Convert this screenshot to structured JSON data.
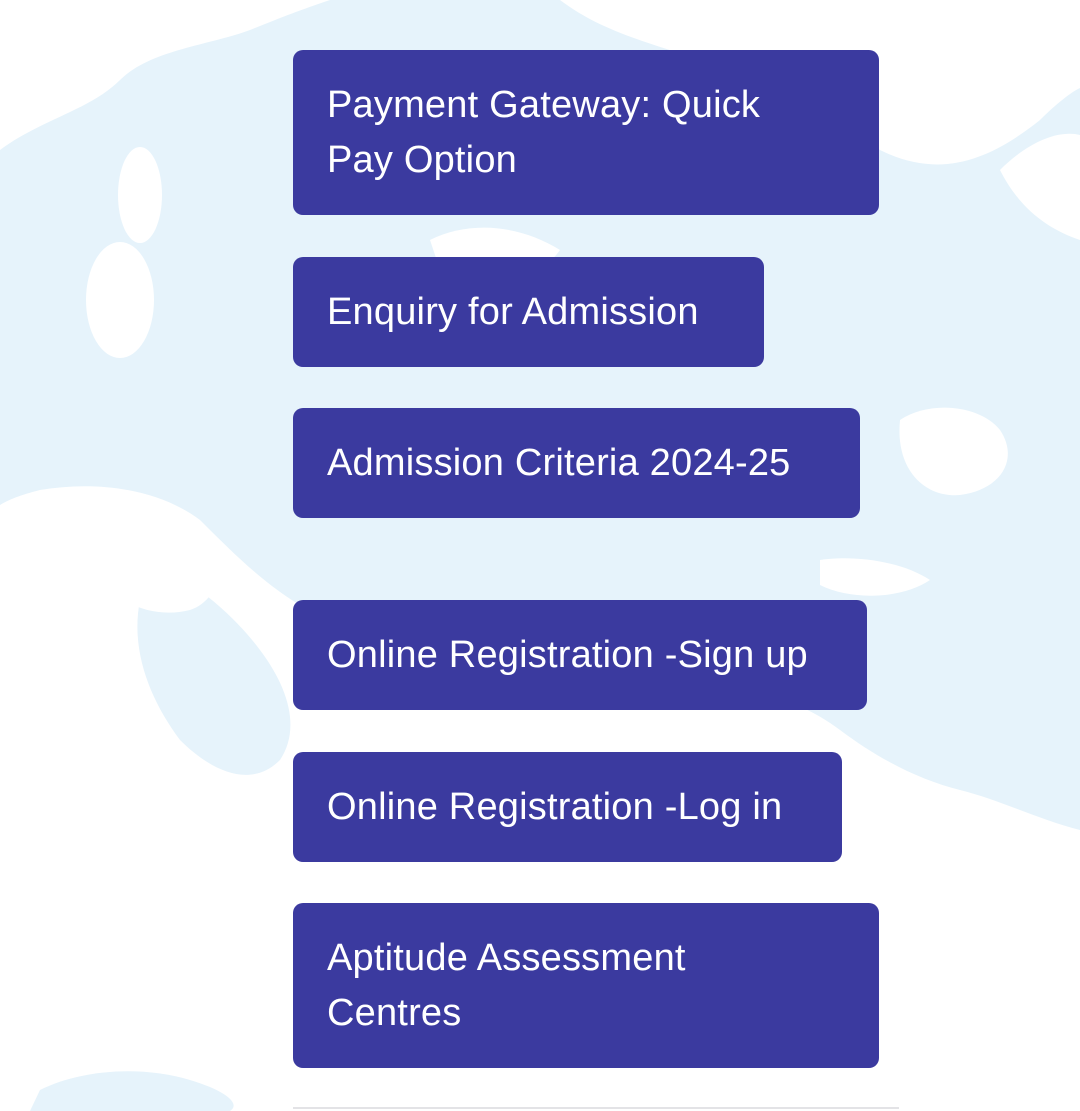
{
  "theme": {
    "button_color": "#3b3a9f",
    "background_map_color": "#e6f3fb"
  },
  "background": {
    "icon": "world-map-watermark"
  },
  "buttons": {
    "payment_gateway": "Payment Gateway: Quick Pay Option",
    "enquiry": "Enquiry for Admission",
    "criteria": "Admission Criteria 2024-25",
    "signup": "Online Registration -Sign up",
    "login": "Online Registration -Log in",
    "aptitude": "Aptitude Assessment Centres"
  }
}
